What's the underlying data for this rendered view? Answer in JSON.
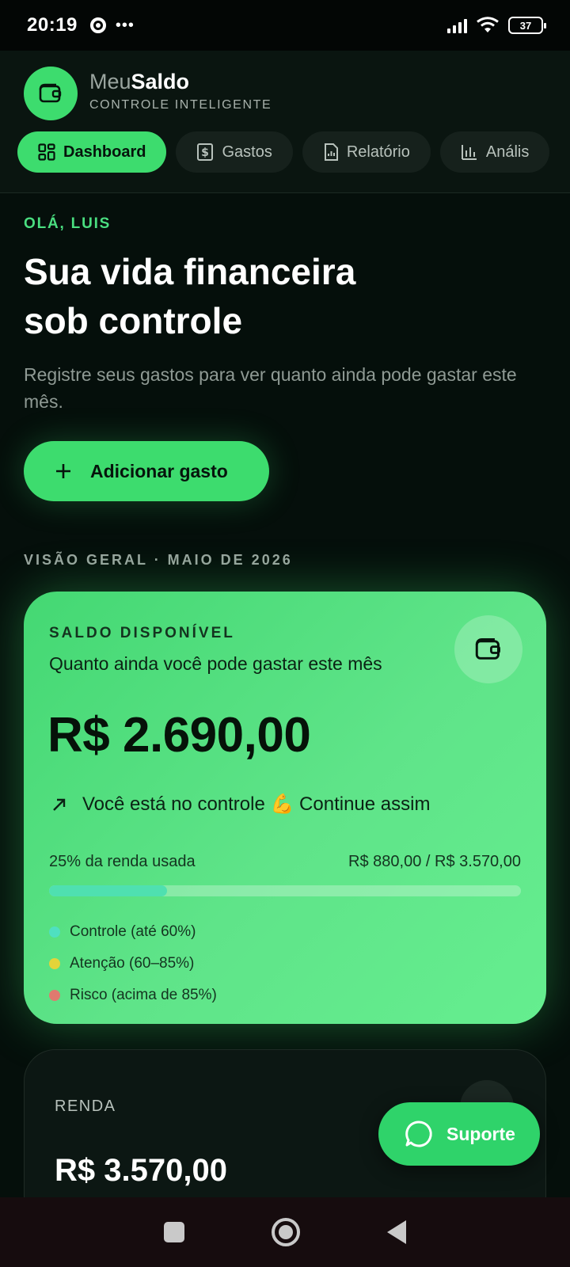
{
  "status_bar": {
    "time": "20:19",
    "overflow": "•••",
    "battery": "37"
  },
  "header": {
    "brand_prefix": "Meu",
    "brand_suffix": "Saldo",
    "brand_subtitle": "CONTROLE INTELIGENTE",
    "logo_icon": "wallet-icon"
  },
  "tabs": [
    {
      "label": "Dashboard",
      "icon": "grid-icon",
      "active": true
    },
    {
      "label": "Gastos",
      "icon": "dollar-receipt-icon",
      "active": false
    },
    {
      "label": "Relatório",
      "icon": "document-icon",
      "active": false
    },
    {
      "label": "Anális",
      "icon": "bar-chart-icon",
      "active": false
    }
  ],
  "hero": {
    "greeting": "OLÁ, LUIS",
    "headline_line1": "Sua vida financeira",
    "headline_line2": "sob controle",
    "subtext": "Registre seus gastos para ver quanto ainda pode gastar este mês.",
    "add_button": "Adicionar gasto"
  },
  "overview_label": "VISÃO GERAL · MAIO DE 2026",
  "balance_card": {
    "label": "SALDO DISPONÍVEL",
    "description": "Quanto ainda você pode gastar este mês",
    "amount": "R$ 2.690,00",
    "status": "Você está no controle 💪 Continue assim",
    "usage_label": "25% da renda usada",
    "usage_values": "R$ 880,00 / R$ 3.570,00",
    "usage_fraction": 0.25,
    "legend": [
      {
        "label": "Controle (até 60%)",
        "color": "#4fe0c0"
      },
      {
        "label": "Atenção (60–85%)",
        "color": "#e3d43a"
      },
      {
        "label": "Risco (acima de 85%)",
        "color": "#e07a6f"
      }
    ]
  },
  "income_card": {
    "label": "RENDA",
    "amount": "R$ 3.570,00"
  },
  "support_button": "Suporte",
  "colors": {
    "accent": "#3ddc6e",
    "background": "#050f0b"
  }
}
